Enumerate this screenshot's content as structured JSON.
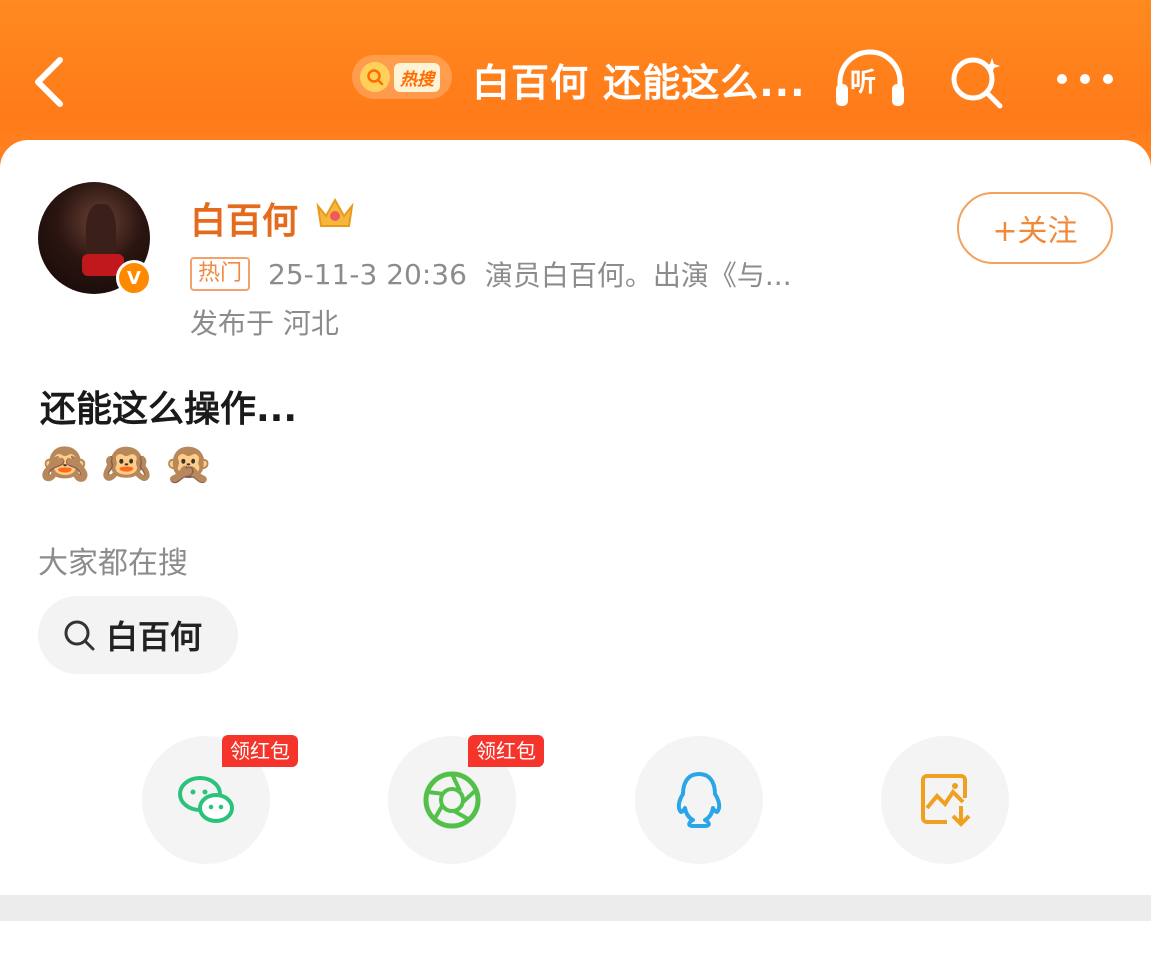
{
  "topbar": {
    "back_label": "<",
    "hot_label": "热搜",
    "title": "白百何 还能这么...",
    "listen_label": "听"
  },
  "post": {
    "author": "白百何",
    "follow_label": "+关注",
    "tag": "热门",
    "time": "25-11-3 20:36",
    "bio": "演员白百何。出演《与...",
    "location": "发布于 河北",
    "text": "还能这么操作...",
    "emojis": [
      "🙈",
      "🙉",
      "🙊"
    ]
  },
  "search_section": {
    "heading": "大家都在搜",
    "chip": "白百何"
  },
  "share": {
    "red_tag_label": "领红包",
    "items": [
      "wechat-icon",
      "moments-icon",
      "qq-icon",
      "save-image-icon"
    ]
  },
  "colors": {
    "accent": "#ff7a19",
    "author": "#e56a1b",
    "wechat": "#2bc27c",
    "qq": "#2aa6e8",
    "save": "#f0a020"
  }
}
